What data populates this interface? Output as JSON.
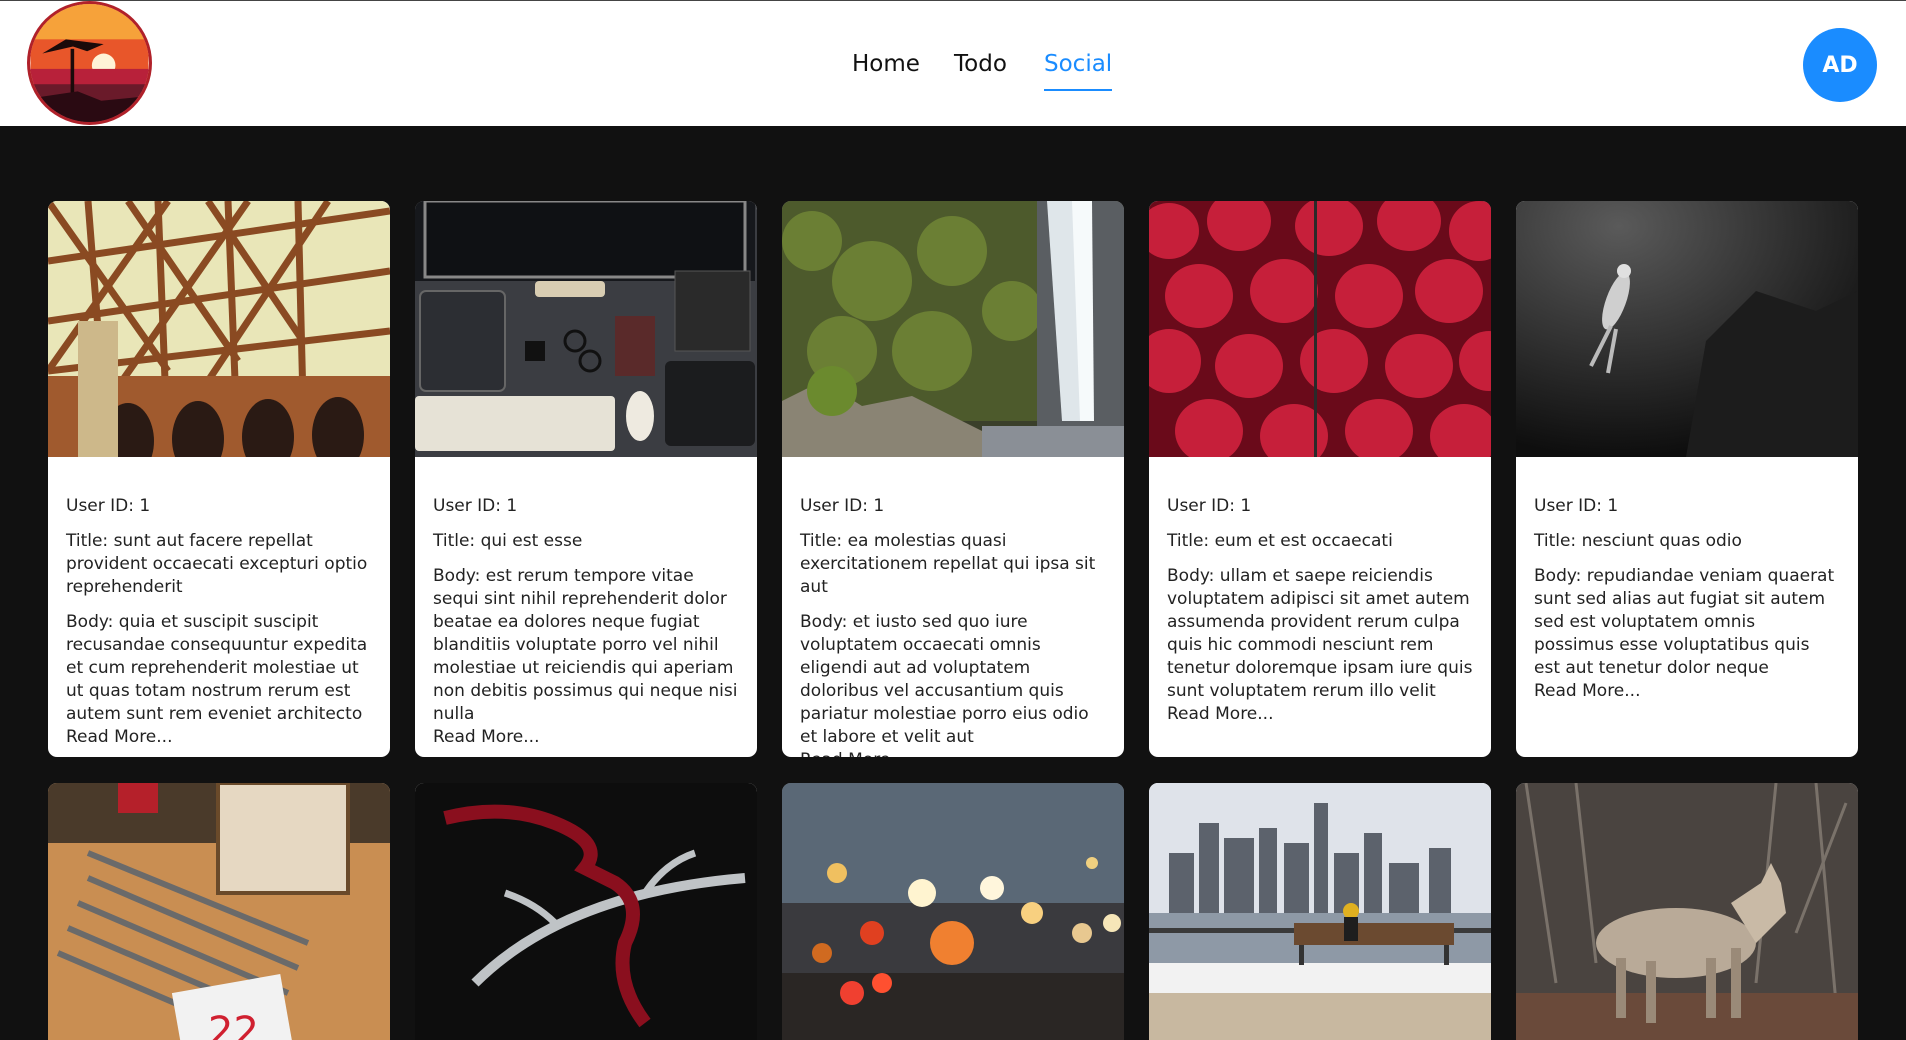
{
  "nav": {
    "home": "Home",
    "todo": "Todo",
    "social": "Social"
  },
  "user": {
    "initials": "AD"
  },
  "labels": {
    "user_id_prefix": "User ID: ",
    "title_prefix": "Title: ",
    "body_prefix": "Body: ",
    "read_more": "Read More..."
  },
  "posts": [
    {
      "user_id": "User ID: 1",
      "title": "Title: sunt aut facere repellat provident occaecati excepturi optio reprehenderit",
      "body": "Body: quia et suscipit suscipit recusandae consequuntur expedita et cum reprehenderit molestiae ut ut quas totam nostrum rerum est autem sunt rem eveniet architecto",
      "image": "bridge-photo"
    },
    {
      "user_id": "User ID: 1",
      "title": "Title: qui est esse",
      "body": "Body: est rerum tempore vitae sequi sint nihil reprehenderit dolor beatae ea dolores neque fugiat blanditiis voluptate porro vel nihil molestiae ut reiciendis qui aperiam non debitis possimus qui neque nisi nulla",
      "image": "desk-setup-photo"
    },
    {
      "user_id": "User ID: 1",
      "title": "Title: ea molestias quasi exercitationem repellat qui ipsa sit aut",
      "body": "Body: et iusto sed quo iure voluptatem occaecati omnis eligendi aut ad voluptatem doloribus vel accusantium quis pariatur molestiae porro eius odio et labore et velit aut",
      "image": "waterfall-photo"
    },
    {
      "user_id": "User ID: 1",
      "title": "Title: eum et est occaecati",
      "body": "Body: ullam et saepe reiciendis voluptatem adipisci sit amet autem assumenda provident rerum culpa quis hic commodi nesciunt rem tenetur doloremque ipsam iure quis sunt voluptatem rerum illo velit",
      "image": "strawberries-photo"
    },
    {
      "user_id": "User ID: 1",
      "title": "Title: nesciunt quas odio",
      "body": "Body: repudiandae veniam quaerat sunt sed alias aut fugiat sit autem sed est voluptatem omnis possimus esse voluptatibus quis est aut tenetur dolor neque",
      "image": "diver-photo"
    }
  ],
  "second_row_images": [
    "pencils-photo",
    "antler-photo",
    "city-bokeh-photo",
    "skyline-bench-photo",
    "coyote-photo"
  ]
}
